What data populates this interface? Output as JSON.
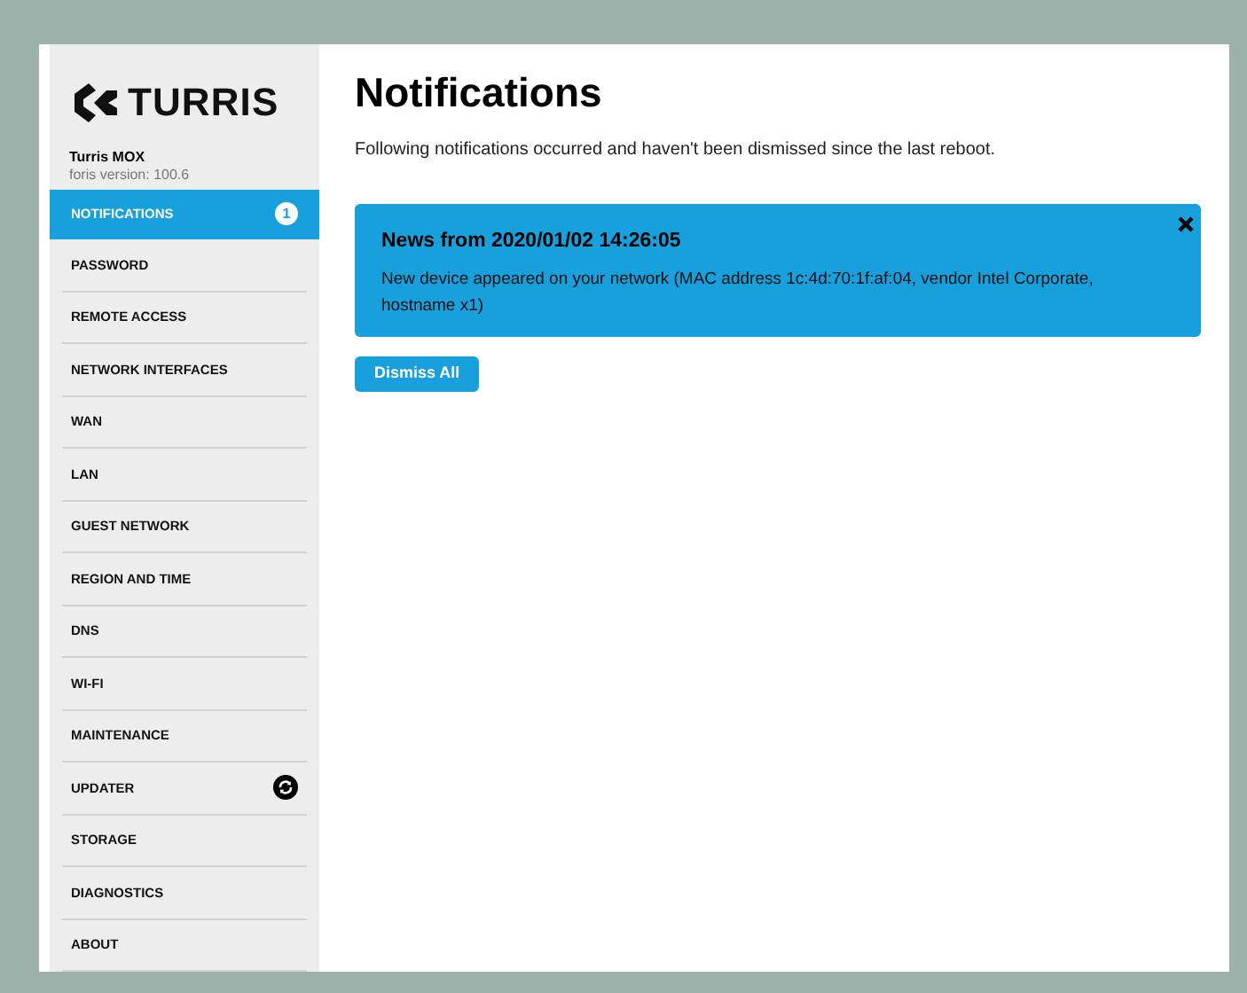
{
  "sidebar": {
    "logo_text": "TURRIS",
    "device": "Turris MOX",
    "version": "foris version: 100.6",
    "items": [
      {
        "label": "NOTIFICATIONS",
        "selected": true,
        "kind": "count",
        "count": "1"
      },
      {
        "label": "PASSWORD",
        "selected": false,
        "kind": "plain"
      },
      {
        "label": "REMOTE ACCESS",
        "selected": false,
        "kind": "plain"
      },
      {
        "label": "NETWORK INTERFACES",
        "selected": false,
        "kind": "plain"
      },
      {
        "label": "WAN",
        "selected": false,
        "kind": "plain"
      },
      {
        "label": "LAN",
        "selected": false,
        "kind": "plain"
      },
      {
        "label": "GUEST NETWORK",
        "selected": false,
        "kind": "plain"
      },
      {
        "label": "REGION AND TIME",
        "selected": false,
        "kind": "plain"
      },
      {
        "label": "DNS",
        "selected": false,
        "kind": "plain"
      },
      {
        "label": "WI-FI",
        "selected": false,
        "kind": "plain"
      },
      {
        "label": "MAINTENANCE",
        "selected": false,
        "kind": "plain"
      },
      {
        "label": "UPDATER",
        "selected": false,
        "kind": "sync"
      },
      {
        "label": "STORAGE",
        "selected": false,
        "kind": "plain"
      },
      {
        "label": "DIAGNOSTICS",
        "selected": false,
        "kind": "plain"
      },
      {
        "label": "ABOUT",
        "selected": false,
        "kind": "plain"
      }
    ]
  },
  "main": {
    "title": "Notifications",
    "description": "Following notifications occurred and haven't been dismissed since the last reboot.",
    "notifications": [
      {
        "title": "News from 2020/01/02 14:26:05",
        "message": "New device appeared on your network (MAC address 1c:4d:70:1f:af:04, vendor Intel Corporate, hostname x1)"
      }
    ],
    "dismiss_all": "Dismiss All"
  }
}
